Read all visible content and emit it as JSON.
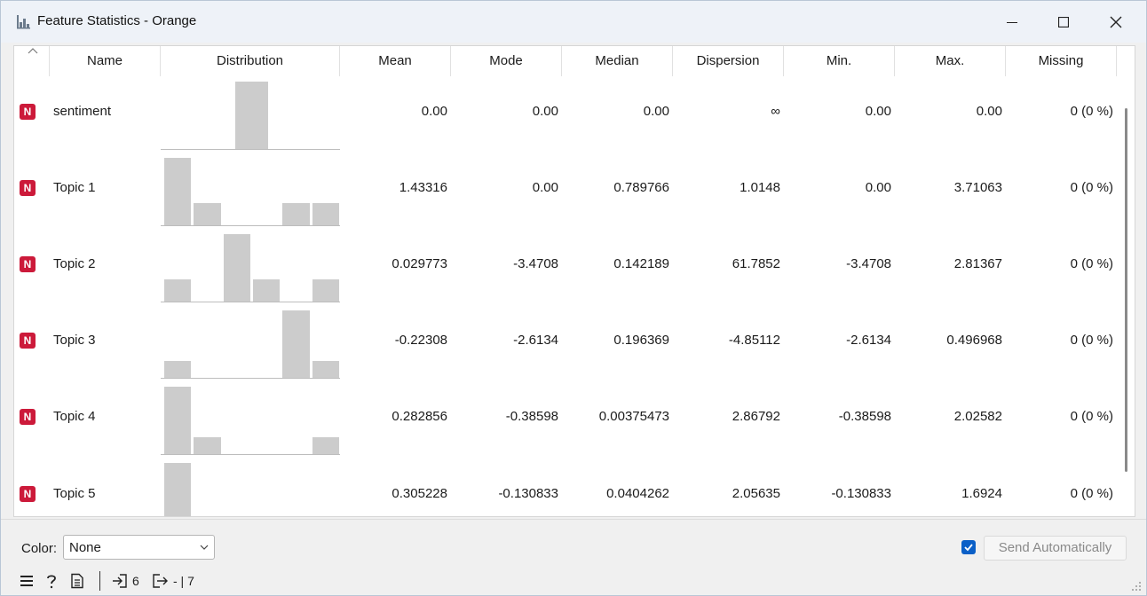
{
  "window": {
    "title": "Feature Statistics - Orange",
    "minimize_icon": "minimize-icon",
    "maximize_icon": "maximize-icon",
    "close_icon": "close-icon"
  },
  "table": {
    "columns": [
      "Name",
      "Distribution",
      "Mean",
      "Mode",
      "Median",
      "Dispersion",
      "Min.",
      "Max.",
      "Missing"
    ],
    "type_badge": "N",
    "rows": [
      {
        "name": "sentiment",
        "mean": "0.00",
        "mode": "0.00",
        "median": "0.00",
        "dispersion": "∞",
        "min": "0.00",
        "max": "0.00",
        "missing": "0 (0 %)",
        "hist": [
          0,
          0,
          1,
          0,
          0
        ]
      },
      {
        "name": "Topic 1",
        "mean": "1.43316",
        "mode": "0.00",
        "median": "0.789766",
        "dispersion": "1.0148",
        "min": "0.00",
        "max": "3.71063",
        "missing": "0 (0 %)",
        "hist": [
          1,
          0.33,
          0,
          0,
          0.33,
          0.33
        ]
      },
      {
        "name": "Topic 2",
        "mean": "0.029773",
        "mode": "-3.4708",
        "median": "0.142189",
        "dispersion": "61.7852",
        "min": "-3.4708",
        "max": "2.81367",
        "missing": "0 (0 %)",
        "hist": [
          0.33,
          0,
          1,
          0.33,
          0,
          0.33
        ]
      },
      {
        "name": "Topic 3",
        "mean": "-0.22308",
        "mode": "-2.6134",
        "median": "0.196369",
        "dispersion": "-4.85112",
        "min": "-2.6134",
        "max": "0.496968",
        "missing": "0 (0 %)",
        "hist": [
          0.25,
          0,
          0,
          0,
          1,
          0.25
        ]
      },
      {
        "name": "Topic 4",
        "mean": "0.282856",
        "mode": "-0.38598",
        "median": "0.00375473",
        "dispersion": "2.86792",
        "min": "-0.38598",
        "max": "2.02582",
        "missing": "0 (0 %)",
        "hist": [
          1,
          0.25,
          0,
          0,
          0,
          0.25
        ]
      },
      {
        "name": "Topic 5",
        "mean": "0.305228",
        "mode": "-0.130833",
        "median": "0.0404262",
        "dispersion": "2.05635",
        "min": "-0.130833",
        "max": "1.6924",
        "missing": "0 (0 %)",
        "hist": [
          1,
          0,
          0,
          0,
          0,
          0.02
        ]
      }
    ]
  },
  "controls": {
    "color_label": "Color:",
    "color_value": "None",
    "send_auto_checked": true,
    "send_auto_label": "Send Automatically"
  },
  "status": {
    "input_count": "6",
    "output_text": "- | 7"
  }
}
